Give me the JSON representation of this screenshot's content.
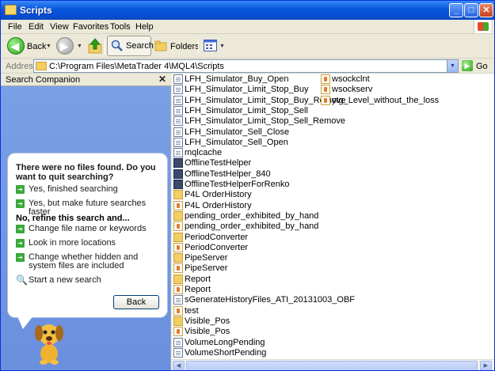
{
  "window": {
    "title": "Scripts"
  },
  "titlebar_buttons": {
    "minimize": "_",
    "maximize": "□",
    "close": "✕"
  },
  "menu": [
    "File",
    "Edit",
    "View",
    "Favorites",
    "Tools",
    "Help"
  ],
  "toolbar": {
    "back_label": "Back",
    "search_label": "Search",
    "folders_label": "Folders"
  },
  "address": {
    "label": "Address",
    "path": "C:\\Program Files\\MetaTrader 4\\MQL4\\Scripts",
    "go_label": "Go"
  },
  "search_companion": {
    "title": "Search Companion",
    "close": "✕",
    "message": "There were no files found.  Do you want to quit searching?",
    "options_quit": [
      "Yes, finished searching",
      "Yes, but make future searches faster"
    ],
    "refine_heading": "No, refine this search and...",
    "options_refine": [
      "Change file name or keywords",
      "Look in more locations",
      "Change whether hidden and system files are included"
    ],
    "new_search": "Start a new search",
    "back_button": "Back"
  },
  "files_col1": [
    {
      "name": "LFH_Simulator_Buy_Open",
      "icon": "doc-icon"
    },
    {
      "name": "LFH_Simulator_Limit_Stop_Buy",
      "icon": "doc-icon"
    },
    {
      "name": "LFH_Simulator_Limit_Stop_Buy_Remove",
      "icon": "doc-icon"
    },
    {
      "name": "LFH_Simulator_Limit_Stop_Sell",
      "icon": "doc-icon"
    },
    {
      "name": "LFH_Simulator_Limit_Stop_Sell_Remove",
      "icon": "doc-icon"
    },
    {
      "name": "LFH_Simulator_Sell_Close",
      "icon": "doc-icon"
    },
    {
      "name": "LFH_Simulator_Sell_Open",
      "icon": "doc-icon"
    },
    {
      "name": "mqlcache",
      "icon": "doc-icon"
    },
    {
      "name": "OfflineTestHelper",
      "icon": "exe-icon"
    },
    {
      "name": "OfflineTestHelper_840",
      "icon": "exe-icon"
    },
    {
      "name": "OfflineTestHelperForRenko",
      "icon": "exe-icon"
    },
    {
      "name": "P4L OrderHistory",
      "icon": "folder-icon"
    },
    {
      "name": "P4L OrderHistory",
      "icon": "mq4-icon"
    },
    {
      "name": "pending_order_exhibited_by_hand",
      "icon": "folder-icon"
    },
    {
      "name": "pending_order_exhibited_by_hand",
      "icon": "mq4-icon"
    },
    {
      "name": "PeriodConverter",
      "icon": "folder-icon"
    },
    {
      "name": "PeriodConverter",
      "icon": "mq4-icon"
    },
    {
      "name": "PipeServer",
      "icon": "folder-icon"
    },
    {
      "name": "PipeServer",
      "icon": "mq4-icon"
    },
    {
      "name": "Report",
      "icon": "folder-icon"
    },
    {
      "name": "Report",
      "icon": "mq4-icon"
    },
    {
      "name": "sGenerateHistoryFiles_ATI_20131003_OBF",
      "icon": "doc-icon"
    },
    {
      "name": "test",
      "icon": "mq4-icon"
    },
    {
      "name": "Visible_Pos",
      "icon": "folder-icon"
    },
    {
      "name": "Visible_Pos",
      "icon": "mq4-icon"
    },
    {
      "name": "VolumeLongPending",
      "icon": "doc-icon"
    },
    {
      "name": "VolumeShortPending",
      "icon": "doc-icon"
    }
  ],
  "files_col2": [
    {
      "name": "wsockclnt",
      "icon": "mq4-icon"
    },
    {
      "name": "wsockserv",
      "icon": "mq4-icon"
    },
    {
      "name": "ytg_Level_without_the_loss",
      "icon": "mq4-icon"
    }
  ]
}
